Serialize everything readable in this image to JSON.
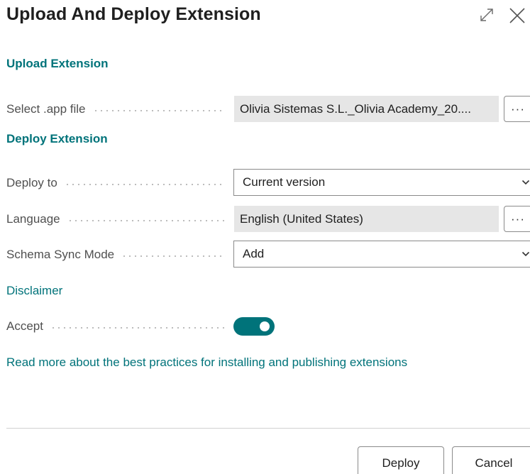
{
  "dialog": {
    "title": "Upload And Deploy Extension"
  },
  "upload_section": {
    "heading": "Upload Extension",
    "app_file": {
      "label": "Select .app file",
      "value": "Olivia Sistemas S.L._Olivia Academy_20....",
      "assist_label": "···"
    }
  },
  "deploy_section": {
    "heading": "Deploy Extension",
    "deploy_to": {
      "label": "Deploy to",
      "value": "Current version"
    },
    "language": {
      "label": "Language",
      "value": "English (United States)",
      "assist_label": "···"
    },
    "schema_sync_mode": {
      "label": "Schema Sync Mode",
      "value": "Add"
    }
  },
  "disclaimer": {
    "link_label": "Disclaimer",
    "accept": {
      "label": "Accept",
      "enabled": true
    }
  },
  "best_practices_link": "Read more about the best practices for installing and publishing extensions",
  "footer": {
    "deploy_label": "Deploy",
    "cancel_label": "Cancel"
  },
  "colors": {
    "accent": "#00737a",
    "readonly_bg": "#e6e6e6"
  }
}
